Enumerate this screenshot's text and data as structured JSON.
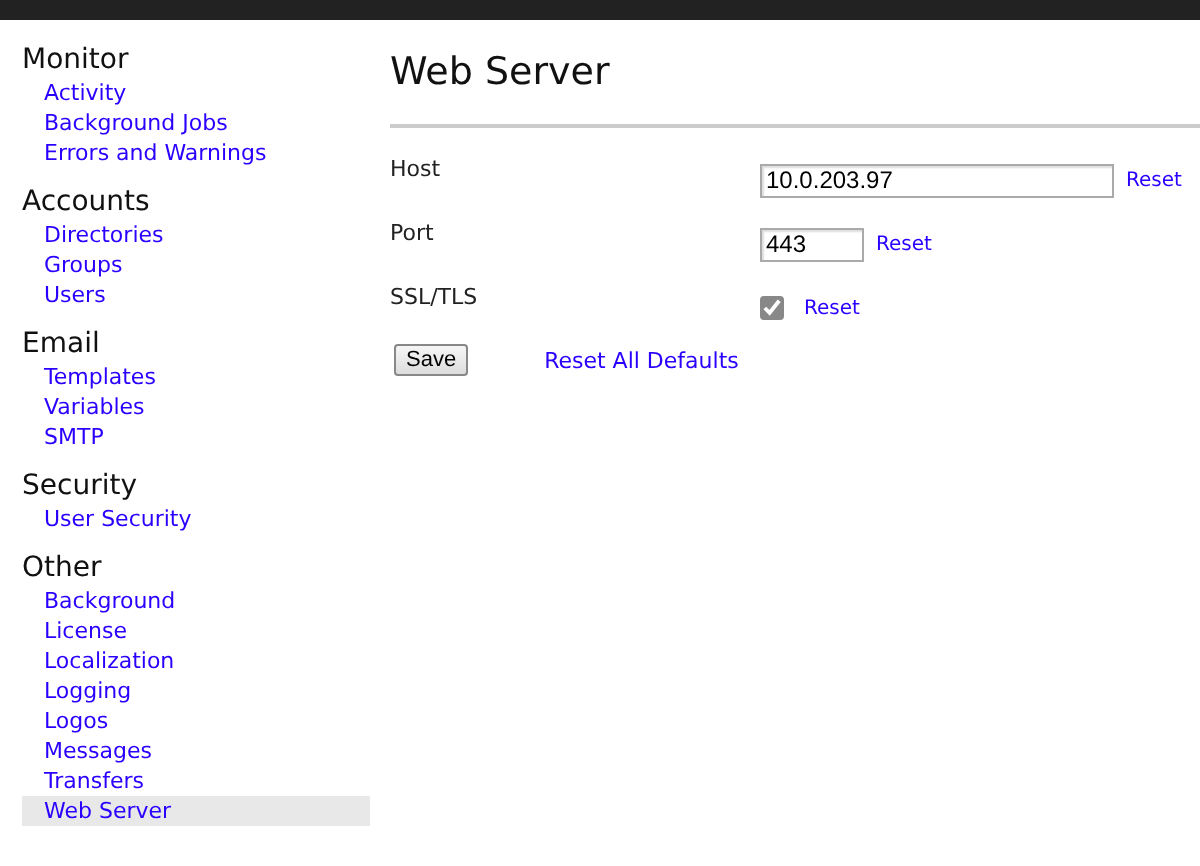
{
  "sidebar": {
    "sections": [
      {
        "heading": "Monitor",
        "items": [
          {
            "label": "Activity",
            "selected": false
          },
          {
            "label": "Background Jobs",
            "selected": false
          },
          {
            "label": "Errors and Warnings",
            "selected": false
          }
        ]
      },
      {
        "heading": "Accounts",
        "items": [
          {
            "label": "Directories",
            "selected": false
          },
          {
            "label": "Groups",
            "selected": false
          },
          {
            "label": "Users",
            "selected": false
          }
        ]
      },
      {
        "heading": "Email",
        "items": [
          {
            "label": "Templates",
            "selected": false
          },
          {
            "label": "Variables",
            "selected": false
          },
          {
            "label": "SMTP",
            "selected": false
          }
        ]
      },
      {
        "heading": "Security",
        "items": [
          {
            "label": "User Security",
            "selected": false
          }
        ]
      },
      {
        "heading": "Other",
        "items": [
          {
            "label": "Background",
            "selected": false
          },
          {
            "label": "License",
            "selected": false
          },
          {
            "label": "Localization",
            "selected": false
          },
          {
            "label": "Logging",
            "selected": false
          },
          {
            "label": "Logos",
            "selected": false
          },
          {
            "label": "Messages",
            "selected": false
          },
          {
            "label": "Transfers",
            "selected": false
          },
          {
            "label": "Web Server",
            "selected": true
          }
        ]
      }
    ]
  },
  "page": {
    "title": "Web Server",
    "fields": [
      {
        "kind": "text",
        "label": "Host",
        "value": "10.0.203.97",
        "reset": "Reset",
        "wide": true
      },
      {
        "kind": "text",
        "label": "Port",
        "value": "443",
        "reset": "Reset",
        "wide": false
      },
      {
        "kind": "checkbox",
        "label": "SSL/TLS",
        "checked": true,
        "reset": "Reset"
      }
    ],
    "save_button": "Save",
    "reset_all": "Reset All Defaults"
  }
}
